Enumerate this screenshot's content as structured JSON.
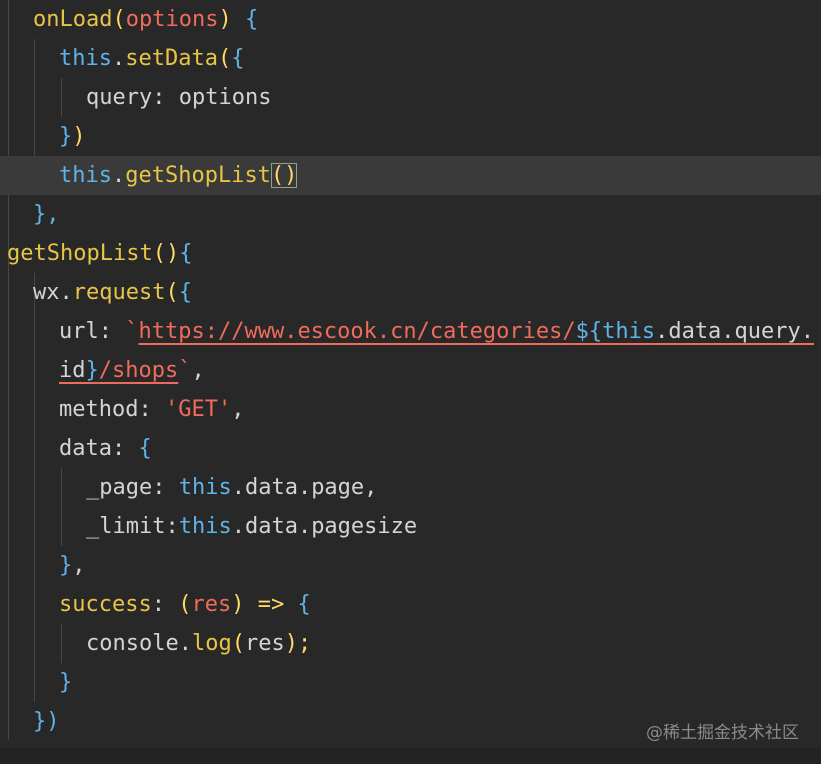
{
  "code_lines": [
    {
      "parts": [
        "onLoad",
        "(",
        "options",
        ") ",
        "{"
      ]
    },
    {
      "parts": [
        "this",
        ".",
        "setData",
        "(",
        "{"
      ]
    },
    {
      "parts": [
        "query",
        ": ",
        "options"
      ]
    },
    {
      "parts": [
        "}",
        ")"
      ]
    },
    {
      "parts": [
        "this",
        ".",
        "getShopList",
        "()",
        ""
      ]
    },
    {
      "parts": [
        "},"
      ]
    },
    {
      "parts": [
        "getShopList",
        "()",
        "{"
      ]
    },
    {
      "parts": [
        "wx",
        ".",
        "request",
        "(",
        "{"
      ]
    },
    {
      "parts": [
        "url",
        ": ",
        "`",
        "https://www.escook.cn/categories/",
        "${",
        "this",
        ".data.query."
      ]
    },
    {
      "parts": [
        "id",
        "}",
        "/shops",
        "`",
        ","
      ]
    },
    {
      "parts": [
        "method",
        ": ",
        "'GET'",
        ","
      ]
    },
    {
      "parts": [
        "data",
        ": ",
        "{"
      ]
    },
    {
      "parts": [
        "_page",
        ": ",
        "this",
        ".data.page",
        ","
      ]
    },
    {
      "parts": [
        "_limit",
        ":",
        "this",
        ".data.pagesize"
      ]
    },
    {
      "parts": [
        "}",
        ","
      ]
    },
    {
      "parts": [
        "success",
        ": ",
        "(",
        "res",
        ") ",
        "=>",
        " {"
      ]
    },
    {
      "parts": [
        "console",
        ".",
        "log",
        "(",
        "res",
        ");"
      ]
    },
    {
      "parts": [
        "}"
      ]
    },
    {
      "parts": [
        "})"
      ]
    }
  ],
  "watermark": "@稀土掘金技术社区",
  "colors": {
    "background": "#282828",
    "current_line": "#3a3a3a",
    "function": "#e7c547",
    "keyword": "#5fb3e8",
    "string": "#ef6b5b",
    "text": "#d4d4d4"
  }
}
